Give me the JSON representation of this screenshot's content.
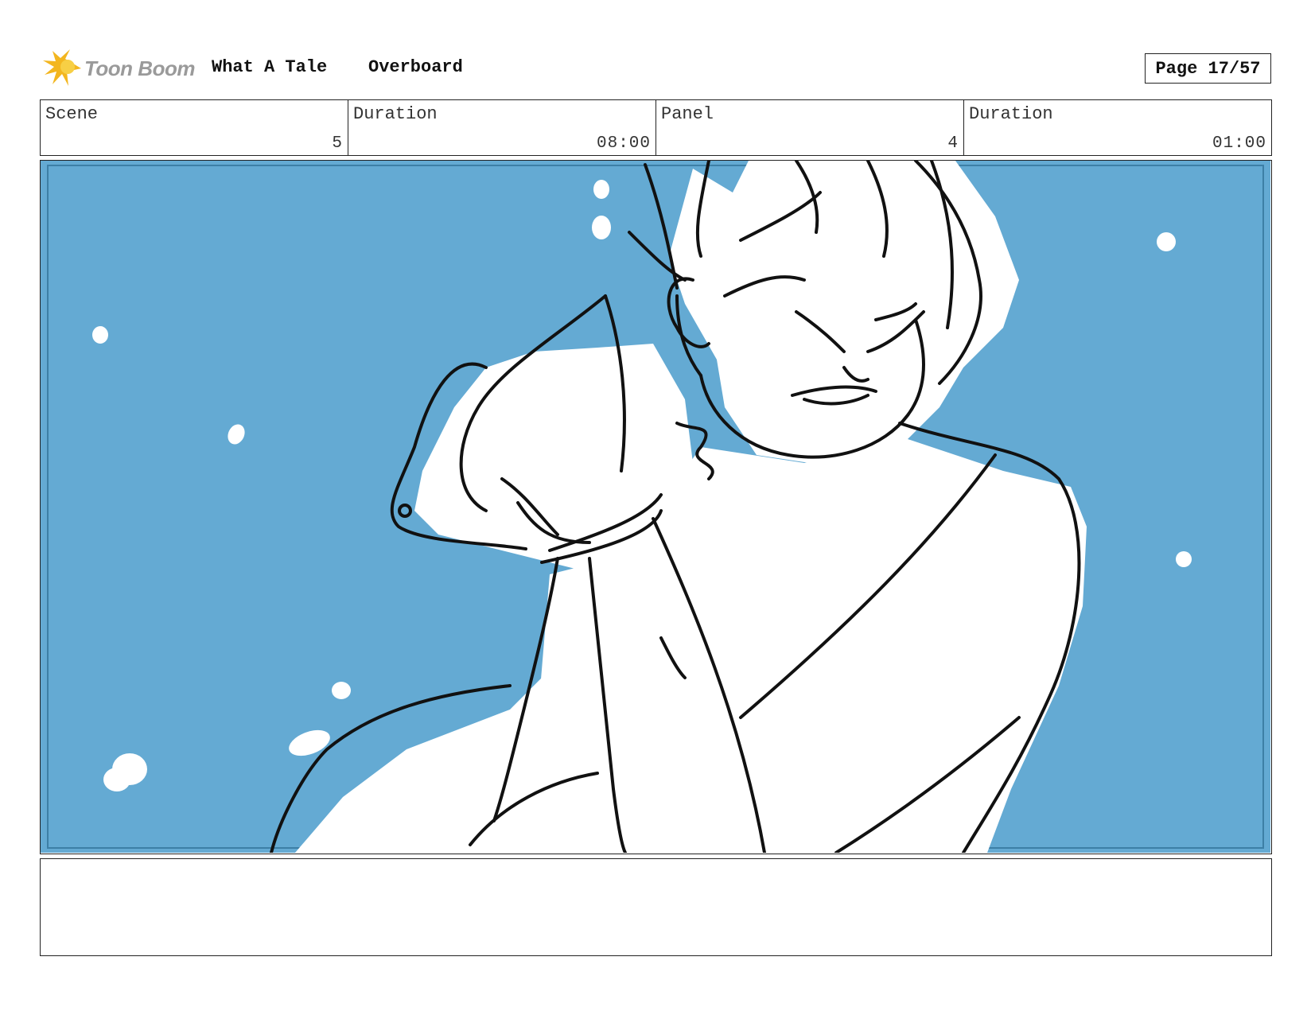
{
  "header": {
    "logo_text": "Toon Boom",
    "project_title": "What A Tale",
    "sequence_title": "Overboard",
    "page_label": "Page 17/57"
  },
  "info": {
    "scene_label": "Scene",
    "scene_value": "5",
    "scene_duration_label": "Duration",
    "scene_duration_value": "08:00",
    "panel_label": "Panel",
    "panel_value": "4",
    "panel_duration_label": "Duration",
    "panel_duration_value": "01:00"
  },
  "colors": {
    "water": "#64aad3",
    "logo_yellow": "#f3b61f",
    "logo_gray": "#9a9a9a"
  },
  "notes": {
    "text": ""
  }
}
